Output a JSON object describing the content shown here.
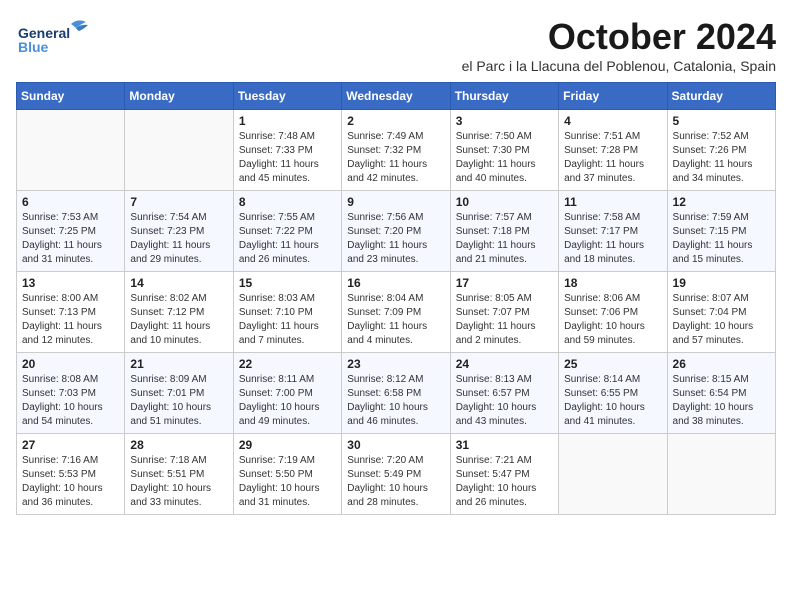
{
  "logo": {
    "line1": "General",
    "line2": "Blue"
  },
  "title": "October 2024",
  "location": "el Parc i la Llacuna del Poblenou, Catalonia, Spain",
  "days_header": [
    "Sunday",
    "Monday",
    "Tuesday",
    "Wednesday",
    "Thursday",
    "Friday",
    "Saturday"
  ],
  "weeks": [
    [
      {
        "num": "",
        "info": ""
      },
      {
        "num": "",
        "info": ""
      },
      {
        "num": "1",
        "info": "Sunrise: 7:48 AM\nSunset: 7:33 PM\nDaylight: 11 hours and 45 minutes."
      },
      {
        "num": "2",
        "info": "Sunrise: 7:49 AM\nSunset: 7:32 PM\nDaylight: 11 hours and 42 minutes."
      },
      {
        "num": "3",
        "info": "Sunrise: 7:50 AM\nSunset: 7:30 PM\nDaylight: 11 hours and 40 minutes."
      },
      {
        "num": "4",
        "info": "Sunrise: 7:51 AM\nSunset: 7:28 PM\nDaylight: 11 hours and 37 minutes."
      },
      {
        "num": "5",
        "info": "Sunrise: 7:52 AM\nSunset: 7:26 PM\nDaylight: 11 hours and 34 minutes."
      }
    ],
    [
      {
        "num": "6",
        "info": "Sunrise: 7:53 AM\nSunset: 7:25 PM\nDaylight: 11 hours and 31 minutes."
      },
      {
        "num": "7",
        "info": "Sunrise: 7:54 AM\nSunset: 7:23 PM\nDaylight: 11 hours and 29 minutes."
      },
      {
        "num": "8",
        "info": "Sunrise: 7:55 AM\nSunset: 7:22 PM\nDaylight: 11 hours and 26 minutes."
      },
      {
        "num": "9",
        "info": "Sunrise: 7:56 AM\nSunset: 7:20 PM\nDaylight: 11 hours and 23 minutes."
      },
      {
        "num": "10",
        "info": "Sunrise: 7:57 AM\nSunset: 7:18 PM\nDaylight: 11 hours and 21 minutes."
      },
      {
        "num": "11",
        "info": "Sunrise: 7:58 AM\nSunset: 7:17 PM\nDaylight: 11 hours and 18 minutes."
      },
      {
        "num": "12",
        "info": "Sunrise: 7:59 AM\nSunset: 7:15 PM\nDaylight: 11 hours and 15 minutes."
      }
    ],
    [
      {
        "num": "13",
        "info": "Sunrise: 8:00 AM\nSunset: 7:13 PM\nDaylight: 11 hours and 12 minutes."
      },
      {
        "num": "14",
        "info": "Sunrise: 8:02 AM\nSunset: 7:12 PM\nDaylight: 11 hours and 10 minutes."
      },
      {
        "num": "15",
        "info": "Sunrise: 8:03 AM\nSunset: 7:10 PM\nDaylight: 11 hours and 7 minutes."
      },
      {
        "num": "16",
        "info": "Sunrise: 8:04 AM\nSunset: 7:09 PM\nDaylight: 11 hours and 4 minutes."
      },
      {
        "num": "17",
        "info": "Sunrise: 8:05 AM\nSunset: 7:07 PM\nDaylight: 11 hours and 2 minutes."
      },
      {
        "num": "18",
        "info": "Sunrise: 8:06 AM\nSunset: 7:06 PM\nDaylight: 10 hours and 59 minutes."
      },
      {
        "num": "19",
        "info": "Sunrise: 8:07 AM\nSunset: 7:04 PM\nDaylight: 10 hours and 57 minutes."
      }
    ],
    [
      {
        "num": "20",
        "info": "Sunrise: 8:08 AM\nSunset: 7:03 PM\nDaylight: 10 hours and 54 minutes."
      },
      {
        "num": "21",
        "info": "Sunrise: 8:09 AM\nSunset: 7:01 PM\nDaylight: 10 hours and 51 minutes."
      },
      {
        "num": "22",
        "info": "Sunrise: 8:11 AM\nSunset: 7:00 PM\nDaylight: 10 hours and 49 minutes."
      },
      {
        "num": "23",
        "info": "Sunrise: 8:12 AM\nSunset: 6:58 PM\nDaylight: 10 hours and 46 minutes."
      },
      {
        "num": "24",
        "info": "Sunrise: 8:13 AM\nSunset: 6:57 PM\nDaylight: 10 hours and 43 minutes."
      },
      {
        "num": "25",
        "info": "Sunrise: 8:14 AM\nSunset: 6:55 PM\nDaylight: 10 hours and 41 minutes."
      },
      {
        "num": "26",
        "info": "Sunrise: 8:15 AM\nSunset: 6:54 PM\nDaylight: 10 hours and 38 minutes."
      }
    ],
    [
      {
        "num": "27",
        "info": "Sunrise: 7:16 AM\nSunset: 5:53 PM\nDaylight: 10 hours and 36 minutes."
      },
      {
        "num": "28",
        "info": "Sunrise: 7:18 AM\nSunset: 5:51 PM\nDaylight: 10 hours and 33 minutes."
      },
      {
        "num": "29",
        "info": "Sunrise: 7:19 AM\nSunset: 5:50 PM\nDaylight: 10 hours and 31 minutes."
      },
      {
        "num": "30",
        "info": "Sunrise: 7:20 AM\nSunset: 5:49 PM\nDaylight: 10 hours and 28 minutes."
      },
      {
        "num": "31",
        "info": "Sunrise: 7:21 AM\nSunset: 5:47 PM\nDaylight: 10 hours and 26 minutes."
      },
      {
        "num": "",
        "info": ""
      },
      {
        "num": "",
        "info": ""
      }
    ]
  ]
}
